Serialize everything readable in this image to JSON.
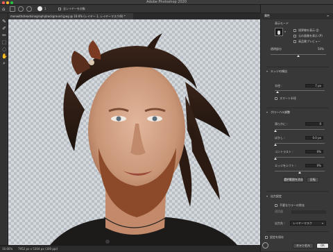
{
  "window": {
    "title": "Adobe Photoshop 2020"
  },
  "options_bar": {
    "brush_size": "1",
    "layer_label": "全レイヤーを対象"
  },
  "document_tab": {
    "label": "menwithdreadsinographybackground.jpeg @ 16.6% (レイヤー 1, レイヤーマスク/8) *"
  },
  "status_bar": {
    "zoom": "16.66%",
    "doc_info": "7952 px x 5304 px (300 ppi)"
  },
  "panel": {
    "header": "属性",
    "view_mode_label": "表示モード",
    "show_edge_label": "境界線を表示 (J)",
    "show_original_label": "元の画像を表示 (P)",
    "hq_preview_label": "高品質プレビュー",
    "transparency_label": "透明部分",
    "transparency_value": "50%",
    "edge_detection_header": "エッジの検出",
    "radius_label": "半径 :",
    "radius_value": "7 px",
    "smart_radius_label": "スマート半径",
    "global_header": "グローバル調整",
    "smooth_label": "滑らかに :",
    "smooth_value": "0",
    "feather_label": "ぼかし :",
    "feather_value": "0.0 px",
    "contrast_label": "コントラスト :",
    "contrast_value": "0%",
    "shift_edge_label": "エッジをシフト :",
    "shift_edge_value": "0%",
    "clear_selection_button": "選択範囲を消去",
    "invert_button": "反転",
    "output_header": "出力設定",
    "decontaminate_label": "不要なカラーの除去",
    "amount_label": "適用量",
    "output_to_label": "出力先 :",
    "output_to_value": "レイヤーマスク",
    "remember_label": "設定を保存",
    "cancel_button": "キャンセル",
    "ok_button": "OK"
  }
}
